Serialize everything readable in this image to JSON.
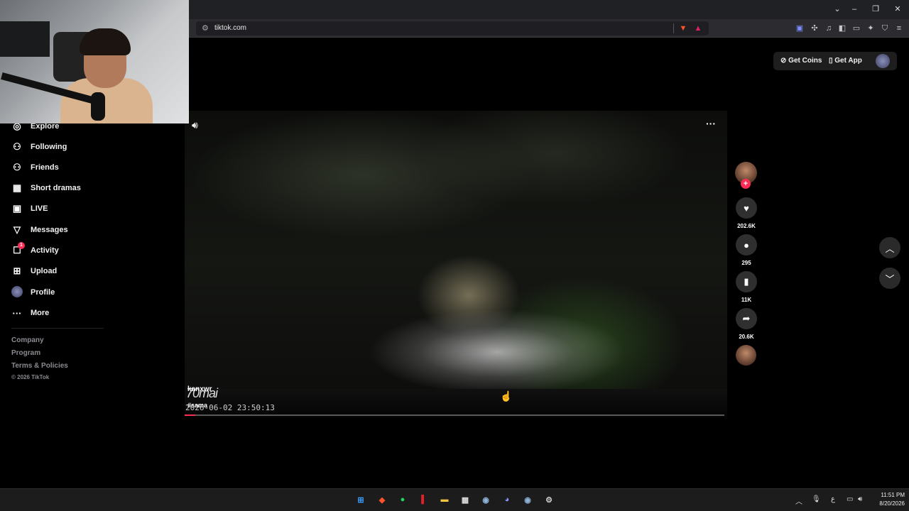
{
  "browser": {
    "url": "tiktok.com",
    "tune_icon": "site-info-icon",
    "extensions": [
      "brave-shield-icon",
      "brave-rewards-icon"
    ],
    "toolbar_icons": [
      "picture-in-picture-icon",
      "extensions-icon",
      "media-icon",
      "sidebar-icon",
      "wallet-icon",
      "leo-icon",
      "vpn-icon",
      "menu-icon"
    ],
    "window_controls": {
      "chevron": "⌄",
      "minimize": "–",
      "restore": "❐",
      "close": "✕"
    }
  },
  "sidebar": {
    "items": [
      {
        "label": "Explore",
        "icon": "compass-icon",
        "glyph": "◎"
      },
      {
        "label": "Following",
        "icon": "following-icon",
        "glyph": "⚇"
      },
      {
        "label": "Friends",
        "icon": "friends-icon",
        "glyph": "⚇"
      },
      {
        "label": "Short dramas",
        "icon": "film-icon",
        "glyph": "▦"
      },
      {
        "label": "LIVE",
        "icon": "live-icon",
        "glyph": "▣"
      },
      {
        "label": "Messages",
        "icon": "messages-icon",
        "glyph": "▽"
      },
      {
        "label": "Activity",
        "icon": "activity-icon",
        "glyph": "☐",
        "badge": "1"
      },
      {
        "label": "Upload",
        "icon": "upload-icon",
        "glyph": "⊞"
      },
      {
        "label": "Profile",
        "icon": "profile-avatar",
        "glyph": "●"
      },
      {
        "label": "More",
        "icon": "more-icon",
        "glyph": "···"
      }
    ],
    "footer_links": [
      "Company",
      "Program",
      "Terms & Policies"
    ],
    "copyright": "© 2026 TikTok"
  },
  "header": {
    "get_coins": "Get Coins",
    "get_app": "Get App"
  },
  "video": {
    "author": "kanxwr",
    "caption": "#sama",
    "watermark": "70mai",
    "timestamp": "2026-06-02 23:50:13",
    "progress": 0.02,
    "volume_icon": "volume-icon",
    "more_icon": "more-options-icon"
  },
  "actions": {
    "likes": "202.6K",
    "comments": "295",
    "saves": "11K",
    "shares": "20.6K"
  },
  "taskbar": {
    "apps": [
      {
        "name": "windows-start-icon",
        "glyph": "⊞",
        "color": "#3aa0ff"
      },
      {
        "name": "brave-browser-icon",
        "glyph": "◆",
        "color": "#fb542b"
      },
      {
        "name": "spotify-icon",
        "glyph": "●",
        "color": "#1ed760"
      },
      {
        "name": "app-red-icon",
        "glyph": "▌",
        "color": "#e2202a"
      },
      {
        "name": "file-explorer-icon",
        "glyph": "▬",
        "color": "#f5c542"
      },
      {
        "name": "store-icon",
        "glyph": "▦",
        "color": "#dddddd"
      },
      {
        "name": "steam-icon",
        "glyph": "◉",
        "color": "#8fb3d9"
      },
      {
        "name": "discord-icon",
        "glyph": "◕",
        "color": "#8a96ff"
      },
      {
        "name": "steam-2-icon",
        "glyph": "◉",
        "color": "#8fb3d9"
      },
      {
        "name": "app-settings-icon",
        "glyph": "⚙",
        "color": "#cccccc"
      }
    ],
    "time": "11:51 PM",
    "date": "8/20/2026",
    "ime": "ع"
  }
}
